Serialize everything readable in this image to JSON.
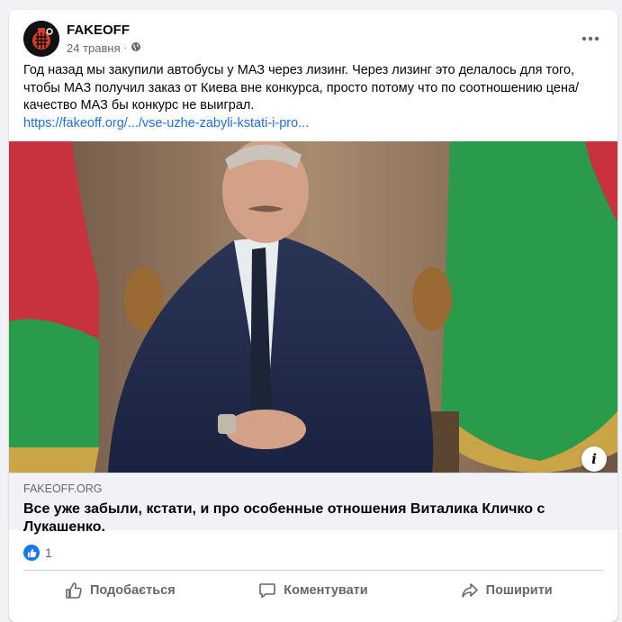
{
  "post": {
    "page_name": "FAKEOFF",
    "date": "24 травня",
    "privacy_icon": "globe-icon",
    "more_icon": "more-horizontal-icon",
    "text": "Год назад мы закупили автобусы у МАЗ через лизинг. Через лизинг это делалось для того, чтобы МАЗ получил заказ от Киева вне конкурса, просто потому что по соотношению цена/качество МАЗ бы конкурс не выиграл.",
    "link_text": "https://fakeoff.org/.../vse-uzhe-zabyli-kstati-i-pro..."
  },
  "preview": {
    "domain": "FAKEOFF.ORG",
    "title": "Все уже забыли, кстати, и про особенные отношения Виталика Кличко с Лукашенко.",
    "info_label": "i"
  },
  "reactions": {
    "count": "1"
  },
  "actions": {
    "like": "Подобається",
    "comment": "Коментувати",
    "share": "Поширити"
  },
  "colors": {
    "link": "#216fdb",
    "secondary_text": "#65676b",
    "like_blue": "#1877f2",
    "flag_red": "#c8313e",
    "flag_green": "#2a9b4a"
  }
}
